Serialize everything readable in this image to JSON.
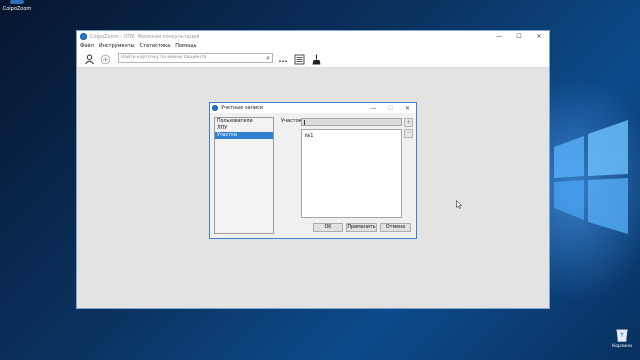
{
  "desktop": {
    "top_icon_label": "ColpoZoom",
    "recycle_bin_label": "Корзина"
  },
  "app": {
    "title": "ColpoZoom - ЛПУ: Женская консультация",
    "window_buttons": {
      "minimize": "—",
      "maximize": "☐",
      "close": "✕"
    },
    "menu": [
      "Файл",
      "Инструменты",
      "Статистика",
      "Помощь"
    ],
    "search": {
      "placeholder": "Найти карточку по имени пациента",
      "value": ""
    },
    "toolbar_more": "..."
  },
  "dialog": {
    "title": "Учетные записи",
    "buttons": {
      "minimize": "—",
      "maximize": "☐",
      "close": "✕"
    },
    "categories": [
      "Пользователи",
      "ЛПУ",
      "Участки"
    ],
    "selected_category": "Участки",
    "field_label": "Участок",
    "field_value": "",
    "items": [
      "№1"
    ],
    "add_symbol": "+",
    "remove_symbol": "—",
    "ok_label": "OK",
    "apply_label": "Применить",
    "cancel_label": "Отмена"
  },
  "colors": {
    "selection": "#2f7fd1",
    "dialog_border": "#3b7fd0",
    "app_background": "#e3e3e3"
  }
}
